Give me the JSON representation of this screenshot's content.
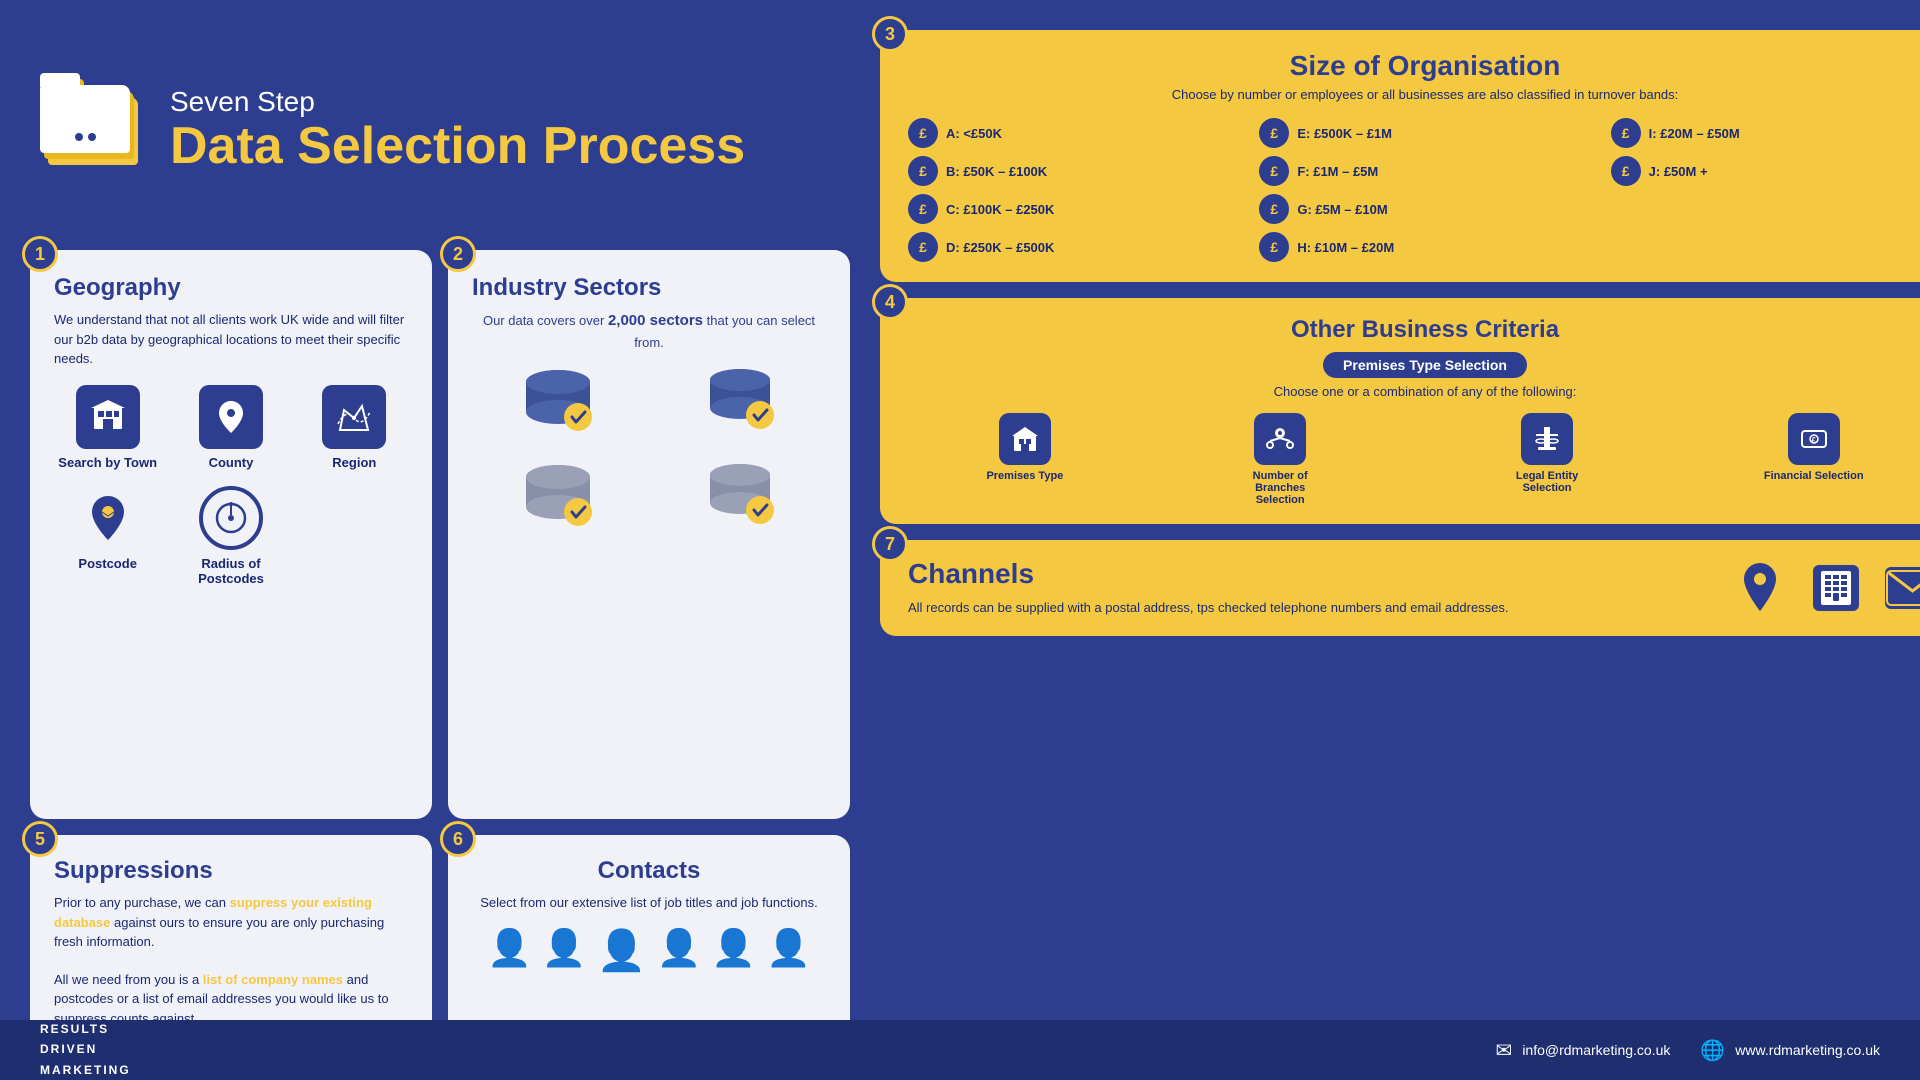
{
  "header": {
    "subtitle": "Seven Step",
    "title": "Data Selection Process"
  },
  "steps": {
    "step1": {
      "number": "1",
      "title": "Geography",
      "body": "We understand that not all clients work UK wide and will filter our b2b data by geographical locations to meet their specific needs.",
      "icons": [
        {
          "name": "Search by Town",
          "icon": "🏢"
        },
        {
          "name": "County",
          "icon": "📍"
        },
        {
          "name": "Region",
          "icon": "🗺"
        },
        {
          "name": "Postcode",
          "icon": "📌"
        },
        {
          "name": "Radius of Postcodes",
          "icon": "🎯"
        }
      ]
    },
    "step2": {
      "number": "2",
      "title": "Industry Sectors",
      "text1": "Our data covers over ",
      "bold": "2,000 sectors",
      "text2": " that you can select from."
    },
    "step3": {
      "number": "3",
      "title": "Size of Organisation",
      "subtitle": "Choose by number or employees or all businesses are also classified in turnover bands:",
      "items": [
        "A: <£50K",
        "E: £500K – £1M",
        "I: £20M – £50M",
        "B: £50K – £100K",
        "F: £1M – £5M",
        "J: £50M +",
        "C: £100K – £250K",
        "G: £5M – £10M",
        "",
        "D: £250K – £500K",
        "H: £10M – £20M",
        ""
      ]
    },
    "step4": {
      "number": "4",
      "title": "Other Business Criteria",
      "badge": "Premises Type Selection",
      "subtitle": "Choose one or a combination of any of the following:",
      "icons": [
        {
          "name": "Premises Type",
          "icon": "🏢"
        },
        {
          "name": "Number of Branches Selection",
          "icon": "📊"
        },
        {
          "name": "Legal Entity Selection",
          "icon": "⚖"
        },
        {
          "name": "Financial Selection",
          "icon": "💷"
        }
      ]
    },
    "step5": {
      "number": "5",
      "title": "Suppressions",
      "body1": "Prior to any purchase, we can ",
      "highlight": "suppress your existing database",
      "body2": " against ours to ensure you are only purchasing fresh information.",
      "body3": "All we need from you is a ",
      "linkText": "list of company names",
      "body4": " and postcodes or a list of email addresses you would like us to suppress counts against."
    },
    "step6": {
      "number": "6",
      "title": "Contacts",
      "body": "Select from our extensive list of job titles and job functions."
    },
    "step7": {
      "number": "7",
      "title": "Channels",
      "body": "All records can be supplied with a postal address, tps checked telephone numbers and email addresses."
    }
  },
  "footer": {
    "brand_line1": "RESULTS",
    "brand_line2": "DRIVEN",
    "brand_line3": "MARKETING",
    "email": "info@rdmarketing.co.uk",
    "website": "www.rdmarketing.co.uk"
  }
}
